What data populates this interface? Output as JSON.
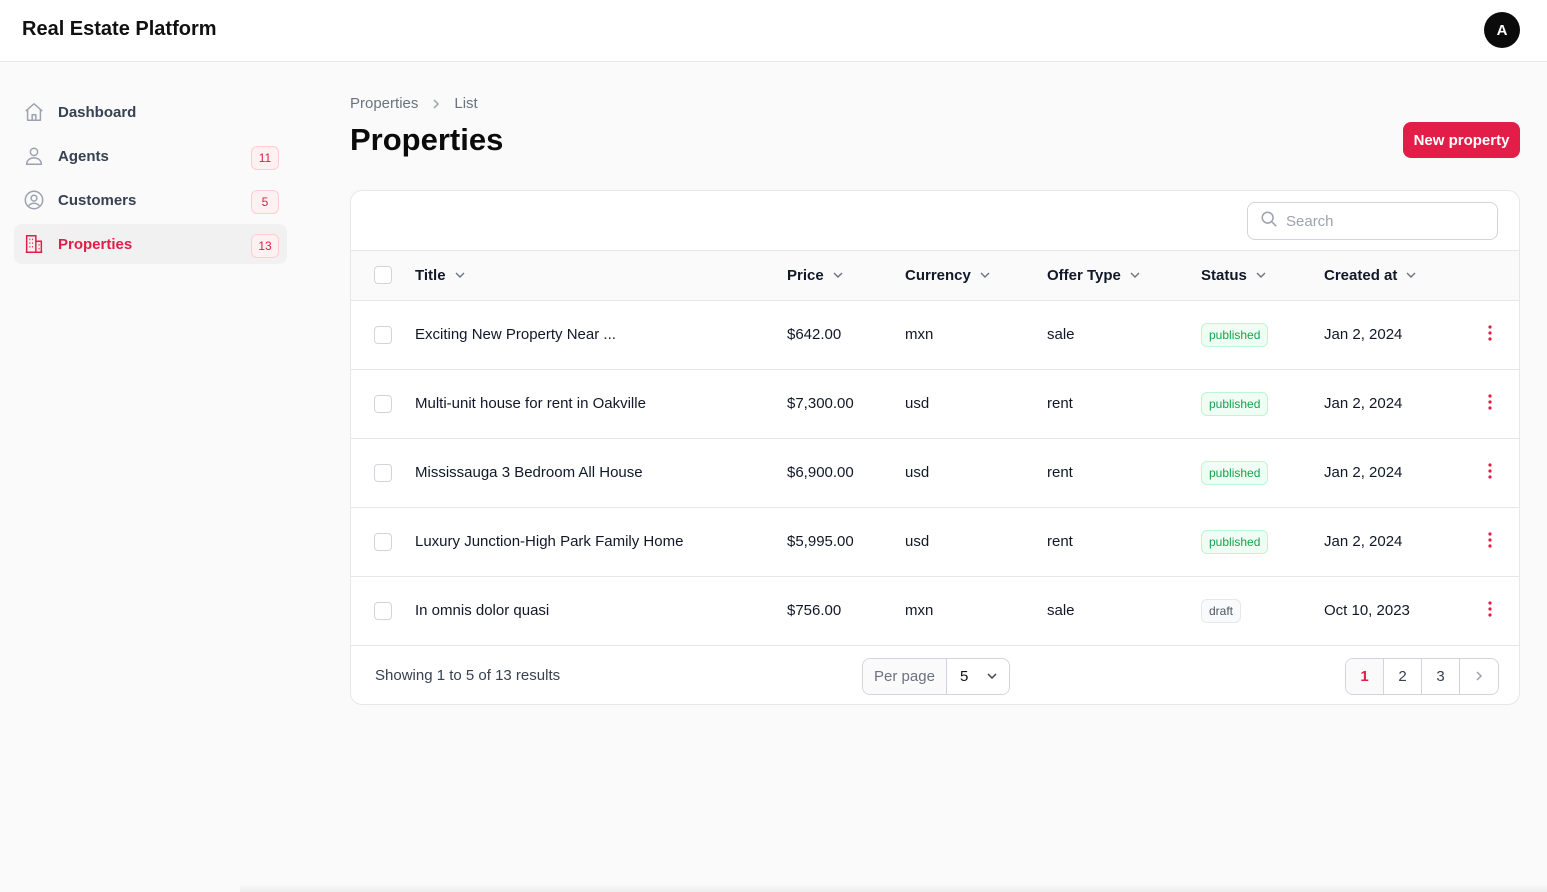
{
  "app": {
    "title": "Real Estate Platform",
    "avatar_initial": "A"
  },
  "sidebar": {
    "items": [
      {
        "label": "Dashboard",
        "icon": "home-icon",
        "badge": ""
      },
      {
        "label": "Agents",
        "icon": "user-icon",
        "badge": "11"
      },
      {
        "label": "Customers",
        "icon": "user-circle-icon",
        "badge": "5"
      },
      {
        "label": "Properties",
        "icon": "building-icon",
        "badge": "13",
        "active": true
      }
    ]
  },
  "breadcrumb": {
    "parent": "Properties",
    "current": "List"
  },
  "page": {
    "title": "Properties",
    "new_button_label": "New property"
  },
  "search": {
    "placeholder": "Search",
    "value": ""
  },
  "table": {
    "columns": [
      "Title",
      "Price",
      "Currency",
      "Offer Type",
      "Status",
      "Created at"
    ],
    "rows": [
      {
        "title": "Exciting New Property Near ...",
        "price": "$642.00",
        "currency": "mxn",
        "offer_type": "sale",
        "status": "published",
        "created_at": "Jan 2, 2024"
      },
      {
        "title": "Multi-unit house for rent in Oakville",
        "price": "$7,300.00",
        "currency": "usd",
        "offer_type": "rent",
        "status": "published",
        "created_at": "Jan 2, 2024"
      },
      {
        "title": "Mississauga 3 Bedroom All House",
        "price": "$6,900.00",
        "currency": "usd",
        "offer_type": "rent",
        "status": "published",
        "created_at": "Jan 2, 2024"
      },
      {
        "title": "Luxury Junction-High Park Family Home",
        "price": "$5,995.00",
        "currency": "usd",
        "offer_type": "rent",
        "status": "published",
        "created_at": "Jan 2, 2024"
      },
      {
        "title": "In omnis dolor quasi",
        "price": "$756.00",
        "currency": "mxn",
        "offer_type": "sale",
        "status": "draft",
        "created_at": "Oct 10, 2023"
      }
    ]
  },
  "footer": {
    "showing": "Showing 1 to 5 of 13 results",
    "per_page_label": "Per page",
    "per_page_value": "5",
    "pages": [
      "1",
      "2",
      "3"
    ],
    "current_page": "1"
  },
  "colors": {
    "accent": "#e11d48",
    "published": "#16a34a",
    "draft": "#4b5563"
  }
}
